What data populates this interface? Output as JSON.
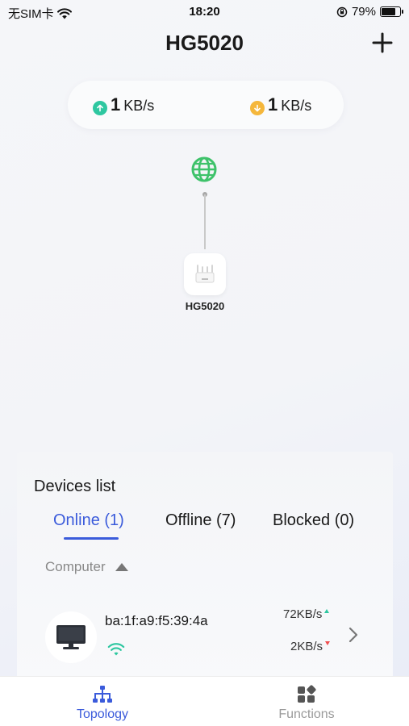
{
  "status_bar": {
    "carrier": "无SIM卡",
    "time": "18:20",
    "battery_percent": "79%",
    "battery_level": 0.79
  },
  "header": {
    "title": "HG5020"
  },
  "speed": {
    "upload_value": "1",
    "upload_unit": "KB/s",
    "download_value": "1",
    "download_unit": "KB/s",
    "upload_color": "#2ec7a0",
    "download_color": "#f5b73b"
  },
  "topology": {
    "router_name": "HG5020",
    "internet_icon": "globe-icon",
    "internet_color": "#3ec26a"
  },
  "devices": {
    "title": "Devices list",
    "tabs": [
      {
        "label": "Online (1)",
        "active": true
      },
      {
        "label": "Offline (7)",
        "active": false
      },
      {
        "label": "Blocked (0)",
        "active": false
      }
    ],
    "category": "Computer",
    "items": [
      {
        "mac": "ba:1f:a9:f5:39:4a",
        "upload_rate": "72KB/s",
        "download_rate": "2KB/s",
        "connection": "wifi-icon"
      }
    ]
  },
  "tabbar": {
    "items": [
      {
        "label": "Topology",
        "active": true,
        "icon": "topology-icon"
      },
      {
        "label": "Functions",
        "active": false,
        "icon": "functions-icon"
      }
    ]
  },
  "colors": {
    "accent": "#3b5bdb",
    "wifi": "#2ec7a0"
  }
}
